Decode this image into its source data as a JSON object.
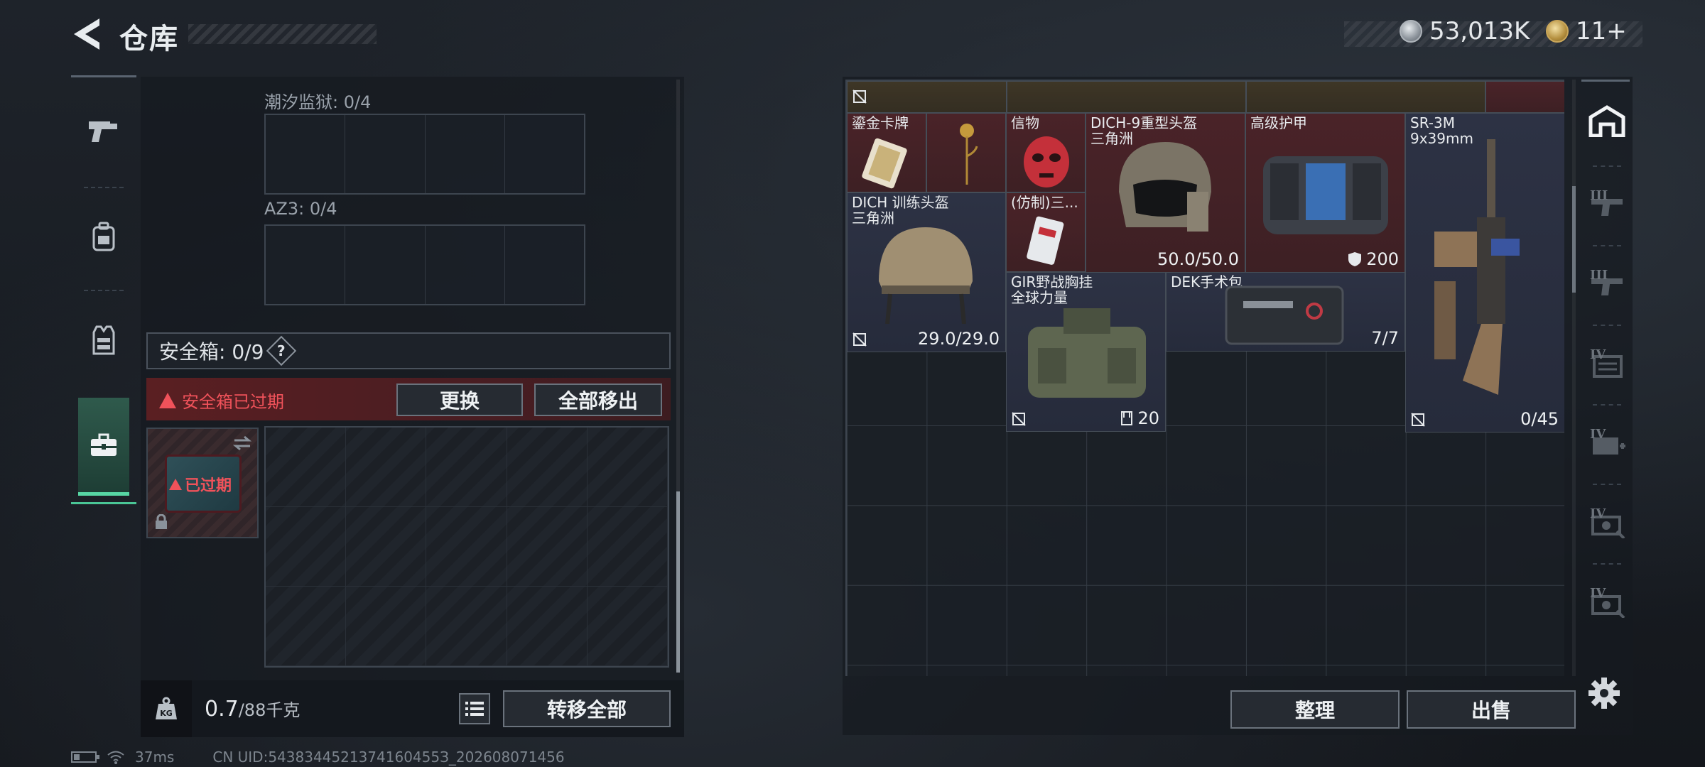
{
  "header": {
    "title": "仓库",
    "currency": [
      {
        "type": "silver",
        "amount": "53,013K"
      },
      {
        "type": "gold",
        "amount": "11+"
      }
    ]
  },
  "left_nav": {
    "items": [
      {
        "icon": "pistol-icon"
      },
      {
        "icon": "backpack-icon"
      },
      {
        "icon": "vest-icon"
      },
      {
        "icon": "briefcase-icon",
        "active": true
      }
    ]
  },
  "left_panel": {
    "container_a_label": "潮汐监狱: 0/4",
    "container_b_label": "AZ3: 0/4",
    "safebox_label": "安全箱: 0/9",
    "help_symbol": "?",
    "expired_message": "安全箱已过期",
    "replace_button": "更换",
    "remove_all_button": "全部移出",
    "case_status": "已过期",
    "weight_value": "0.7",
    "weight_capacity": "/88千克",
    "kg_badge": "KG",
    "transfer_all_button": "转移全部"
  },
  "inventory": {
    "items": [
      {
        "name": "鎏金卡牌",
        "stat": "",
        "color": "red"
      },
      {
        "name": "信物",
        "stat": "",
        "color": "red"
      },
      {
        "name": "DICH-9重型头盔\n三角洲",
        "stat": "50.0/50.0",
        "color": "red"
      },
      {
        "name": "高级护甲",
        "stat": "200",
        "color": "red"
      },
      {
        "name": "SR-3M\n9x39mm",
        "stat": "0/45",
        "color": "blue"
      },
      {
        "name": "DICH 训练头盔\n三角洲",
        "stat": "29.0/29.0",
        "color": "blue"
      },
      {
        "name": "(仿制)三...",
        "stat": "",
        "color": "blue"
      },
      {
        "name": "GIR野战胸挂\n全球力量",
        "stat": "20",
        "color": "blue"
      },
      {
        "name": "DEK手术包",
        "stat": "7/7",
        "color": "blue"
      }
    ],
    "sort_button": "整理",
    "sell_button": "出售"
  },
  "right_nav": {
    "tiers": [
      "",
      "III",
      "III",
      "IV",
      "IV",
      "IV",
      "IV"
    ]
  },
  "status_bar": {
    "ping": "37ms",
    "uid": "CN UID:5438344521374160455З_202608071456"
  }
}
